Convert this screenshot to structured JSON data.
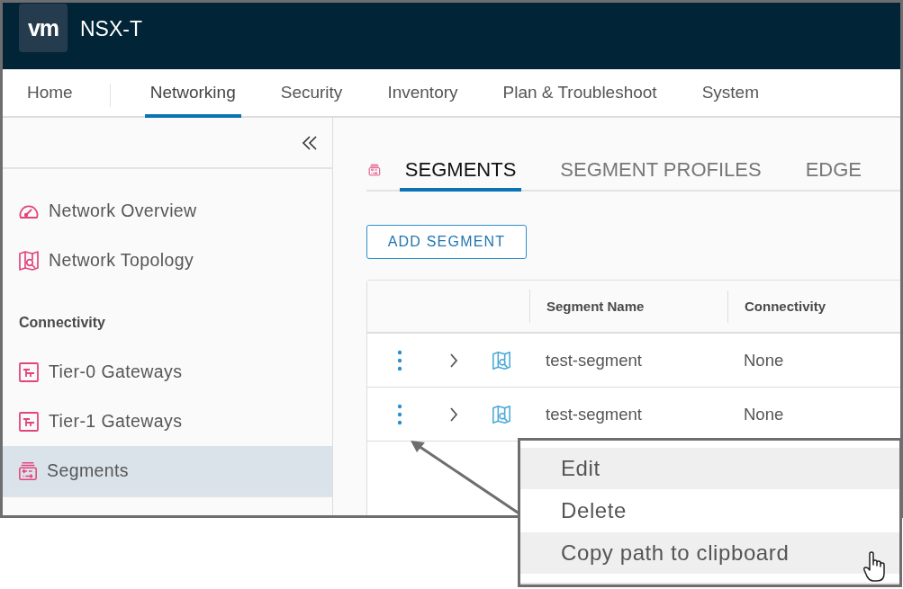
{
  "header": {
    "logo": "vm",
    "title": "NSX-T"
  },
  "nav_tabs": [
    {
      "label": "Home",
      "selected": false
    },
    {
      "label": "Networking",
      "selected": true
    },
    {
      "label": "Security",
      "selected": false
    },
    {
      "label": "Inventory",
      "selected": false
    },
    {
      "label": "Plan & Troubleshoot",
      "selected": false
    },
    {
      "label": "System",
      "selected": false
    }
  ],
  "sidebar": {
    "items": [
      {
        "kind": "link",
        "label": "Network Overview",
        "selected": false
      },
      {
        "kind": "link",
        "label": "Network Topology",
        "selected": false
      },
      {
        "kind": "header",
        "label": "Connectivity"
      },
      {
        "kind": "link",
        "label": "Tier-0 Gateways",
        "selected": false
      },
      {
        "kind": "link",
        "label": "Tier-1 Gateways",
        "selected": false
      },
      {
        "kind": "link",
        "label": "Segments",
        "selected": true
      }
    ]
  },
  "content": {
    "tabs": [
      {
        "label": "SEGMENTS",
        "selected": true
      },
      {
        "label": "SEGMENT PROFILES",
        "selected": false
      },
      {
        "label": "EDGE",
        "selected": false
      }
    ],
    "add_button": "ADD SEGMENT",
    "table": {
      "columns": [
        "Segment Name",
        "Connectivity"
      ],
      "rows": [
        {
          "name": "test-segment",
          "connectivity": "None"
        },
        {
          "name": "test-segment",
          "connectivity": "None"
        }
      ]
    }
  },
  "callout_menu": {
    "items": [
      {
        "label": "Edit",
        "highlighted": true
      },
      {
        "label": "Delete",
        "highlighted": false
      },
      {
        "label": "Copy path to clipboard",
        "highlighted": true
      }
    ]
  }
}
